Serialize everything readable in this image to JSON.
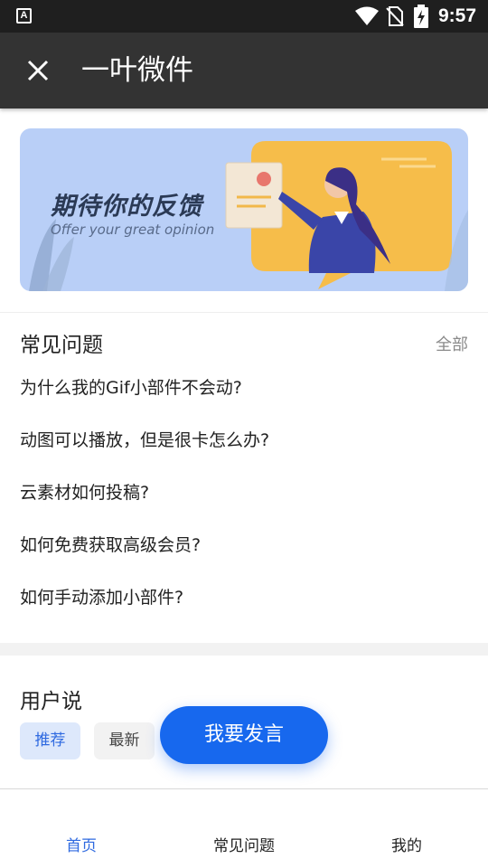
{
  "status_bar": {
    "app_icon_letter": "A",
    "time": "9:57",
    "icons": [
      "wifi-icon",
      "no-sim-icon",
      "battery-charging-icon"
    ]
  },
  "app_bar": {
    "title": "一叶微件",
    "close_icon": "close-icon"
  },
  "banner": {
    "title": "期待你的反馈",
    "subtitle": "Offer your great opinion",
    "background_color": "#b9cff7",
    "bubble_color": "#f6bd4a"
  },
  "faq": {
    "title": "常见问题",
    "all_label": "全部",
    "items": [
      "为什么我的Gif小部件不会动?",
      "动图可以播放，但是很卡怎么办?",
      "云素材如何投稿?",
      "如何免费获取高级会员?",
      "如何手动添加小部件?"
    ]
  },
  "user_says": {
    "title": "用户说",
    "chips": [
      "推荐",
      "最新"
    ]
  },
  "fab": {
    "label": "我要发言",
    "color": "#1768ee"
  },
  "bottom_nav": {
    "items": [
      "首页",
      "常见问题",
      "我的"
    ],
    "active_color": "#2f6ae0"
  }
}
